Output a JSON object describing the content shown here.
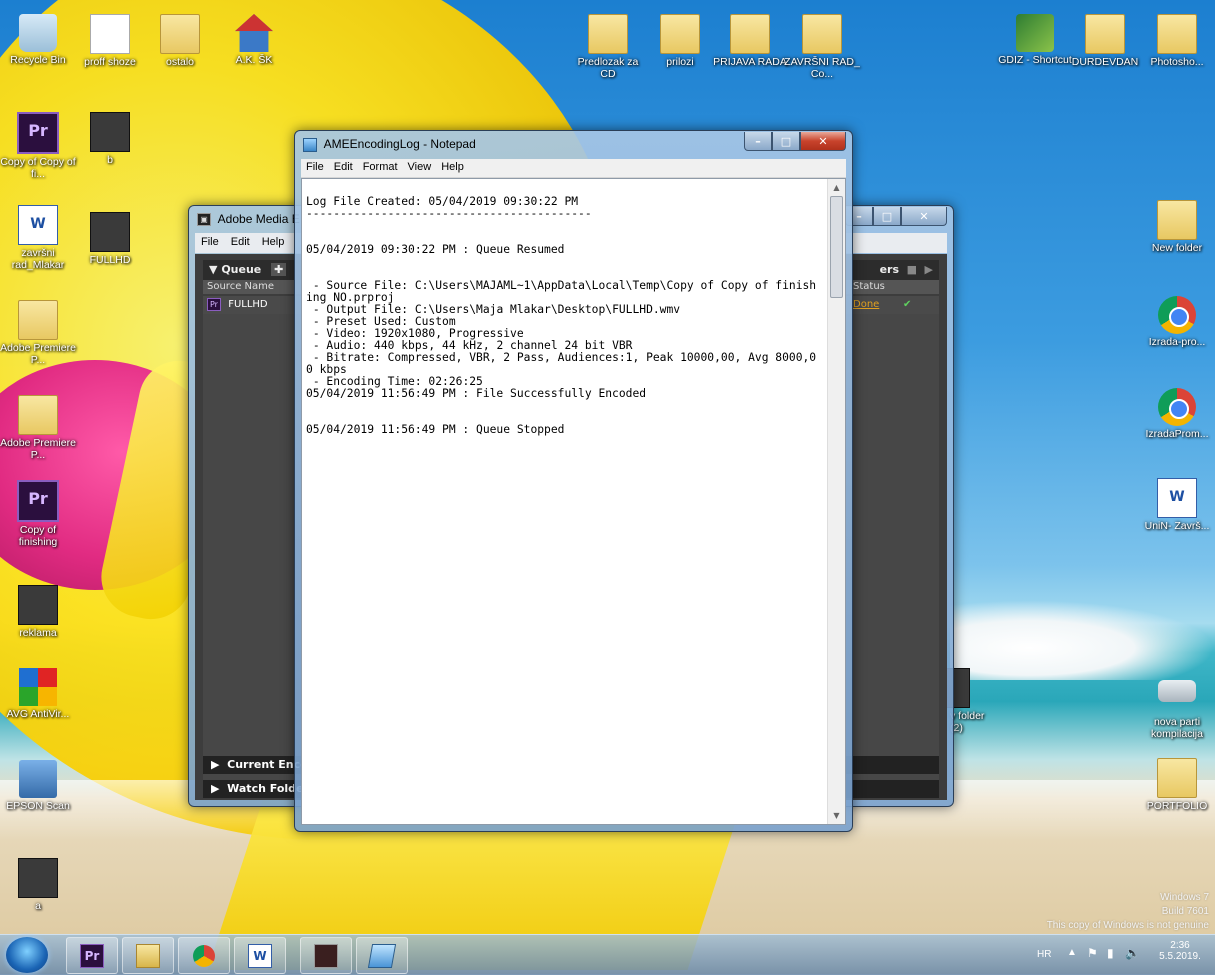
{
  "desktop": {
    "icons": [
      {
        "label": "Recycle Bin"
      },
      {
        "label": "proff shoze"
      },
      {
        "label": "ostalo"
      },
      {
        "label": "A.K. ŠK"
      },
      {
        "label": "Copy of Copy of fi..."
      },
      {
        "label": "b"
      },
      {
        "label": "završni rad_Mlakar"
      },
      {
        "label": "FULLHD"
      },
      {
        "label": "Adobe Premiere P..."
      },
      {
        "label": "Adobe Premiere P..."
      },
      {
        "label": "Copy of finishing"
      },
      {
        "label": "reklama"
      },
      {
        "label": "AVG AntiVir..."
      },
      {
        "label": "EPSON Scan"
      },
      {
        "label": "a"
      },
      {
        "label": "Predlozak za CD"
      },
      {
        "label": "prilozi"
      },
      {
        "label": "PRIJAVA RADA"
      },
      {
        "label": "ZAVRŠNI RAD_ Co..."
      },
      {
        "label": "GDIZ - Shortcut"
      },
      {
        "label": "DURDEVDAN"
      },
      {
        "label": "Photosho..."
      },
      {
        "label": "New folder"
      },
      {
        "label": "Izrada-pro..."
      },
      {
        "label": "IzradaProm..."
      },
      {
        "label": "UniN- Završ..."
      },
      {
        "label": "nova parti kompilacija"
      },
      {
        "label": "PORTFOLIO"
      },
      {
        "label": "v folder (2)"
      }
    ]
  },
  "ame": {
    "title": "Adobe Media E",
    "menu": [
      "File",
      "Edit",
      "Help"
    ],
    "queue_label": "Queue",
    "col_source": "Source Name",
    "col_status": "Status",
    "col_presets_partial": "ers",
    "row_source": "FULLHD",
    "row_status": "Done",
    "current_encoding": "Current Enco",
    "watch_folder": "Watch Folder"
  },
  "notepad": {
    "title": "AMEEncodingLog - Notepad",
    "menu": [
      "File",
      "Edit",
      "Format",
      "View",
      "Help"
    ],
    "content": "\nLog File Created: 05/04/2019 09:30:22 PM\n------------------------------------------\n\n\n05/04/2019 09:30:22 PM : Queue Resumed\n\n\n - Source File: C:\\Users\\MAJAML~1\\AppData\\Local\\Temp\\Copy of Copy of finishing NO.prproj\n - Output File: C:\\Users\\Maja Mlakar\\Desktop\\FULLHD.wmv\n - Preset Used: Custom\n - Video: 1920x1080, Progressive\n - Audio: 440 kbps, 44 kHz, 2 channel 24 bit VBR\n - Bitrate: Compressed, VBR, 2 Pass, Audiences:1, Peak 10000,00, Avg 8000,00 kbps\n - Encoding Time: 02:26:25\n05/04/2019 11:56:49 PM : File Successfully Encoded\n\n\n05/04/2019 11:56:49 PM : Queue Stopped"
  },
  "watermark": {
    "line1": "Windows 7",
    "line2": "Build 7601",
    "line3": "This copy of Windows is not genuine"
  },
  "tray": {
    "lang": "HR",
    "time": "2:36",
    "date": "5.5.2019."
  },
  "taskbar": {
    "apps": [
      {
        "icon": "premiere-icon",
        "text": "Pr"
      },
      {
        "icon": "explorer-icon",
        "text": ""
      },
      {
        "icon": "chrome-icon",
        "text": ""
      },
      {
        "icon": "word-icon",
        "text": "W"
      },
      {
        "icon": "media-encoder-icon",
        "text": ""
      },
      {
        "icon": "notepad-icon",
        "text": ""
      }
    ]
  }
}
